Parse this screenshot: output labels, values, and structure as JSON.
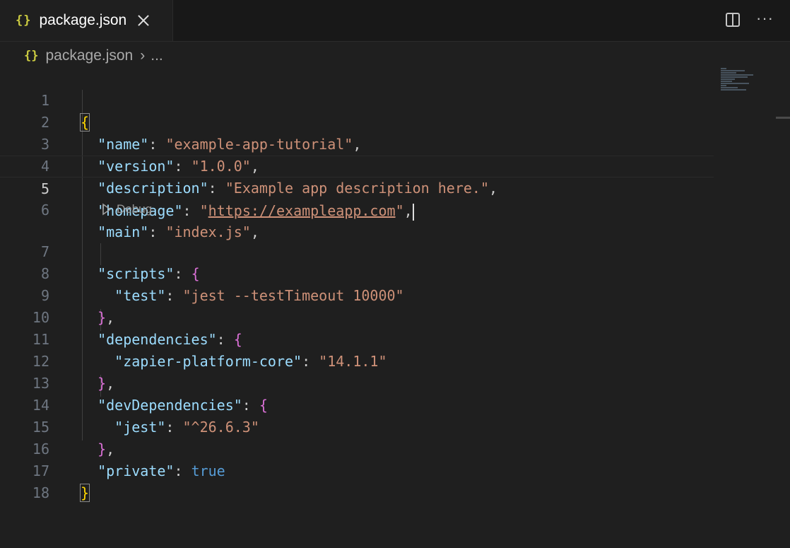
{
  "tab": {
    "label": "package.json",
    "icon": "{}"
  },
  "breadcrumb": {
    "file": "package.json",
    "more": "..."
  },
  "toolbar": {
    "more": "···"
  },
  "codelens": {
    "label": "Debug"
  },
  "line_numbers": [
    "1",
    "2",
    "3",
    "4",
    "5",
    "6",
    "7",
    "8",
    "9",
    "10",
    "11",
    "12",
    "13",
    "14",
    "15",
    "16",
    "17",
    "18"
  ],
  "active_line": "5",
  "code": {
    "l2": {
      "key": "\"name\"",
      "val": "\"example-app-tutorial\""
    },
    "l3": {
      "key": "\"version\"",
      "val": "\"1.0.0\""
    },
    "l4": {
      "key": "\"description\"",
      "val": "\"Example app description here.\""
    },
    "l5": {
      "key": "\"homepage\"",
      "q": "\"",
      "url": "https://exampleapp.com",
      "q2": "\""
    },
    "l6": {
      "key": "\"main\"",
      "val": "\"index.js\""
    },
    "l7": {
      "key": "\"scripts\""
    },
    "l8": {
      "key": "\"test\"",
      "val": "\"jest --testTimeout 10000\""
    },
    "l10": {
      "key": "\"dependencies\""
    },
    "l11": {
      "key": "\"zapier-platform-core\"",
      "val": "\"14.1.1\""
    },
    "l13": {
      "key": "\"devDependencies\""
    },
    "l14": {
      "key": "\"jest\"",
      "val": "\"^26.6.3\""
    },
    "l16": {
      "key": "\"private\"",
      "val": "true"
    }
  },
  "colors": {
    "key": "#9cdcfe",
    "string": "#ce9178",
    "bool": "#569cd6",
    "brace": "#ffd700",
    "brace2": "#da70d6"
  }
}
